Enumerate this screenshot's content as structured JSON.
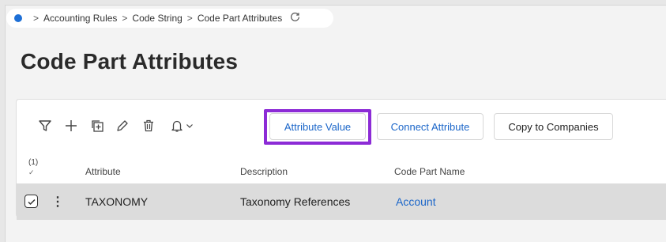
{
  "breadcrumb": {
    "items": [
      "Accounting Rules",
      "Code String",
      "Code Part Attributes"
    ],
    "separator": ">",
    "refresh_icon": "refresh-icon"
  },
  "page": {
    "title": "Code Part Attributes"
  },
  "toolbar": {
    "icons": [
      "filter-icon",
      "add-icon",
      "duplicate-icon",
      "edit-icon",
      "delete-icon",
      "bell-icon",
      "chevron-down-icon"
    ],
    "buttons": {
      "attribute_value": "Attribute Value",
      "connect_attribute": "Connect Attribute",
      "copy_to_companies": "Copy to Companies"
    }
  },
  "table": {
    "selection_count": "(1)",
    "selection_mark": "✓",
    "columns": {
      "attribute": "Attribute",
      "description": "Description",
      "code_part_name": "Code Part Name"
    },
    "rows": [
      {
        "attribute": "TAXONOMY",
        "description": "Taxonomy References",
        "code_part_name": "Account",
        "selected": true
      }
    ]
  },
  "colors": {
    "accent_link": "#1b66c9",
    "highlight": "#8c2bd6",
    "selected_row": "#dcdcdc"
  }
}
